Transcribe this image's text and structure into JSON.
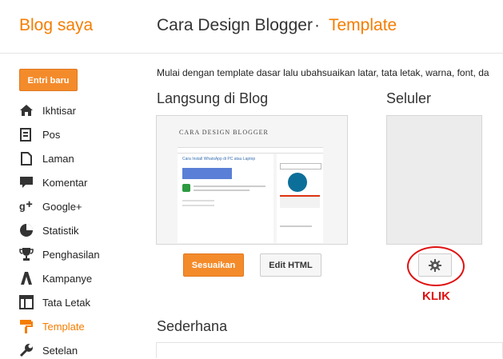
{
  "header": {
    "brand": "Blog saya",
    "blog_name": "Cara Design Blogger",
    "separator": "·",
    "page": "Template"
  },
  "sidebar": {
    "new_post": "Entri baru",
    "items": [
      {
        "label": "Ikhtisar",
        "icon": "home-icon"
      },
      {
        "label": "Pos",
        "icon": "posts-icon"
      },
      {
        "label": "Laman",
        "icon": "pages-icon"
      },
      {
        "label": "Komentar",
        "icon": "comment-icon"
      },
      {
        "label": "Google+",
        "icon": "google-plus-icon"
      },
      {
        "label": "Statistik",
        "icon": "stats-icon"
      },
      {
        "label": "Penghasilan",
        "icon": "trophy-icon"
      },
      {
        "label": "Kampanye",
        "icon": "campaign-icon"
      },
      {
        "label": "Tata Letak",
        "icon": "layout-icon"
      },
      {
        "label": "Template",
        "icon": "template-icon",
        "active": true
      },
      {
        "label": "Setelan",
        "icon": "wrench-icon"
      }
    ]
  },
  "main": {
    "intro": "Mulai dengan template dasar lalu ubahsuaikan latar, tata letak, warna, font, da",
    "live_title": "Langsung di Blog",
    "mobile_title": "Seluler",
    "customize_label": "Sesuaikan",
    "edit_html_label": "Edit HTML",
    "annotation": "KLIK",
    "simple_title": "Sederhana",
    "preview": {
      "blog_title": "CARA DESIGN BLOGGER",
      "post_title": "Cara Install WhatsApp di PC atau Laptop"
    }
  },
  "colors": {
    "accent": "#f57d00",
    "button": "#f48b2b",
    "annotation": "#e01010"
  }
}
